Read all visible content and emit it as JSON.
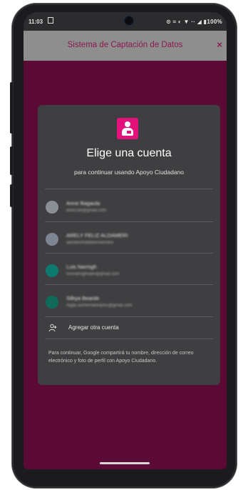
{
  "status_bar": {
    "time": "11:03",
    "icons": "⊙ ≈ ◐ ▼ ·· ◢ ▮100%"
  },
  "app_bar": {
    "title": "Sistema de Captación de Datos",
    "close_glyph": "×"
  },
  "dialog": {
    "title": "Elige una cuenta",
    "subtitle": "para continuar usando Apoyo Ciudadano",
    "accounts": [
      {
        "name": "Anne Bagaula",
        "email": "aneccah@gmail.com",
        "avatar_color": "#8a8f96"
      },
      {
        "name": "ARELY FELIZ ALDAMERI",
        "email": "aandecimafelesnoeirolos",
        "avatar_color": "#7d8592"
      },
      {
        "name": "Luis Narmgh",
        "email": "luisnarmghoam@gmail.com",
        "avatar_color": "#0d7a70"
      },
      {
        "name": "Silkya Bearde",
        "email": "mppu.asmemarespinc@gmail.com",
        "avatar_color": "#0f6a5a"
      }
    ],
    "add_account": "Agregar otra cuenta",
    "footer": "Para continuar, Google compartirá tu nombre, dirección de correo electrónico y foto de perfil con Apoyo Ciudadano."
  },
  "colors": {
    "background": "#5a0a35",
    "accent": "#e3127a",
    "dialog": "#3f3f41",
    "app_bar": "#8e8e8e"
  }
}
